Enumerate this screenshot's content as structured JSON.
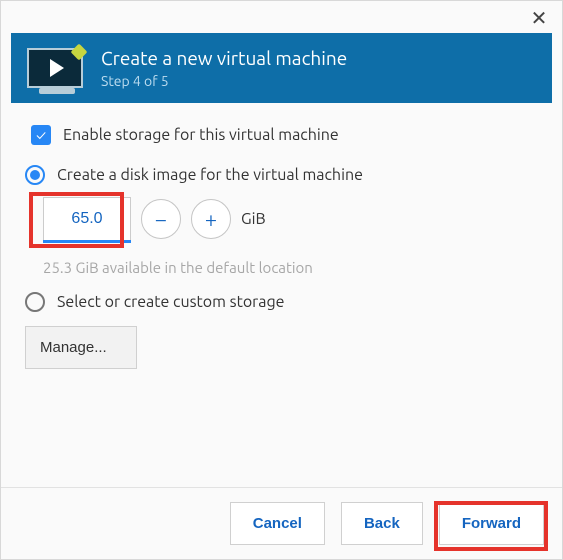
{
  "header": {
    "title": "Create a new virtual machine",
    "subtitle": "Step 4 of 5"
  },
  "storage": {
    "enable_label": "Enable storage for this virtual machine",
    "create_disk_label": "Create a disk image for the virtual machine",
    "size_value": "65.0",
    "size_unit": "GiB",
    "available_hint": "25.3 GiB available in the default location",
    "custom_storage_label": "Select or create custom storage",
    "manage_label": "Manage..."
  },
  "footer": {
    "cancel": "Cancel",
    "back": "Back",
    "forward": "Forward"
  }
}
